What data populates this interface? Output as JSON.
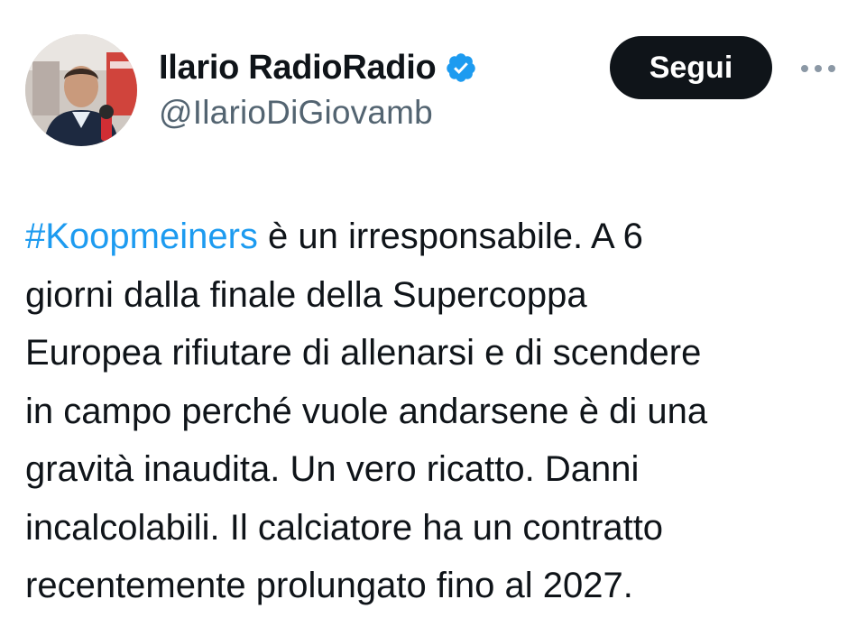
{
  "author": {
    "display_name": "Ilario RadioRadio",
    "handle": "@IlarioDiGiovamb",
    "verified": true,
    "avatar_icon": "profile-photo"
  },
  "actions": {
    "follow_label": "Segui",
    "more_icon": "more-horizontal-icon"
  },
  "tweet": {
    "hashtag": "#Koopmeiners",
    "body": " è un irresponsabile. A 6\ngiorni dalla finale della Supercoppa\nEuropea rifiutare di allenarsi e di scendere\nin campo perché vuole andarsene è di una\ngravità inaudita. Un vero ricatto. Danni\nincalcolabili. Il calciatore ha un contratto\nrecentemente prolungato fino al 2027."
  },
  "colors": {
    "accent": "#1d9bf0",
    "text": "#0f1419",
    "secondary": "#536471",
    "button_bg": "#0f1419"
  }
}
